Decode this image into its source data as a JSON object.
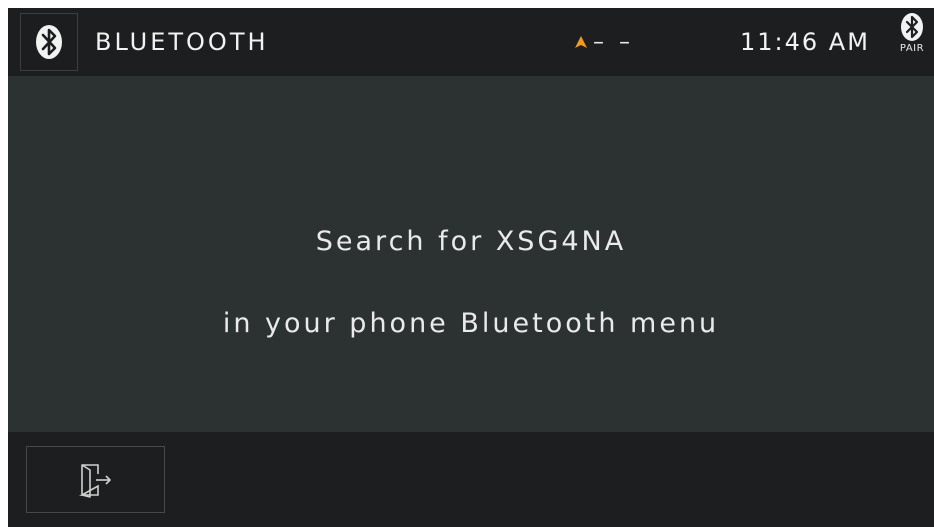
{
  "header": {
    "title": "BLUETOOTH",
    "nav_indicator": "– –",
    "clock": "11:46 AM",
    "pair_label": "PAIR",
    "accent_color": "#f39a1e"
  },
  "main": {
    "line1": "Search for XSG4NA",
    "line2": "in your phone Bluetooth menu"
  },
  "footer": {
    "exit_icon": "exit-icon"
  }
}
